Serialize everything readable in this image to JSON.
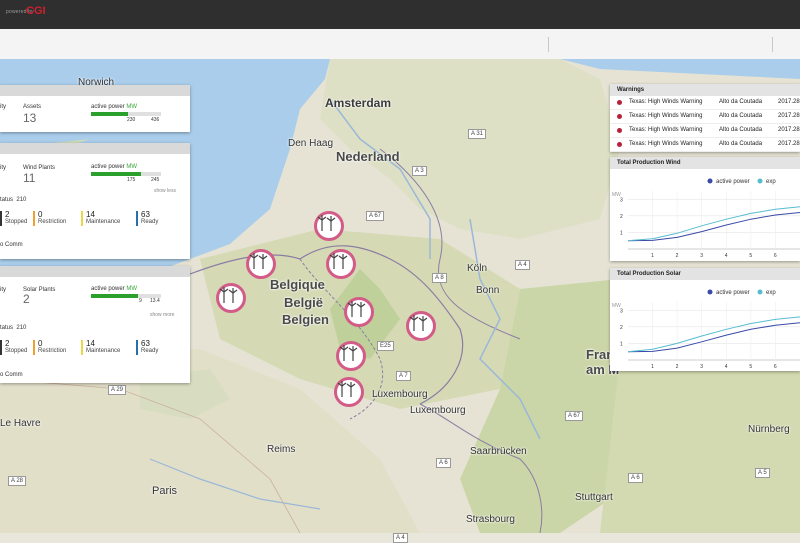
{
  "header": {
    "powered_by": "powered by",
    "logo": "CGI"
  },
  "map": {
    "cities": [
      "Amsterdam",
      "Den Haag",
      "Köln",
      "Bonn",
      "Reims",
      "Paris",
      "Le Havre",
      "Luxembourg",
      "Saarbrücken",
      "Stuttgart",
      "Strasbourg",
      "Nürnberg",
      "Norwich"
    ],
    "countries": {
      "nl": "Nederland",
      "be1": "Belgique",
      "be2": "België",
      "be3": "Belgien",
      "fr1": "Fran",
      "fr2": "am M",
      "lu": "Luxembourg"
    },
    "roads": [
      "A 31",
      "A 67",
      "A 3",
      "A 4",
      "A 8",
      "A 7",
      "A 6",
      "A 5",
      "E25",
      "A 29",
      "A 28",
      "A 4",
      "A 4",
      "A 67",
      "A 6"
    ]
  },
  "cards": {
    "assets": {
      "label_left": "ity",
      "assets_label": "Assets",
      "assets_value": "13",
      "power_label": "active power",
      "unit": "MW",
      "p1": "230",
      "p2": "436"
    },
    "wind": {
      "label_left": "ity",
      "plants_label": "Wind Plants",
      "plants_value": "11",
      "power_label": "active power",
      "unit": "MW",
      "p1": "175",
      "p2": "245",
      "show_less": "show less",
      "status_label": "tatus",
      "status_value": "210",
      "stats": [
        {
          "num": "2",
          "txt": "Stopped"
        },
        {
          "num": "0",
          "txt": "Restriction"
        },
        {
          "num": "14",
          "txt": "Maintenance"
        },
        {
          "num": "63",
          "txt": "Ready"
        }
      ],
      "no_comm": "o Comm"
    },
    "solar": {
      "label_left": "ity",
      "plants_label": "Solar Plants",
      "plants_value": "2",
      "power_label": "active power",
      "unit": "MW",
      "p1": "9",
      "p2": "13.4",
      "show_more": "show more",
      "status_label": "tatus",
      "status_value": "210",
      "stats": [
        {
          "num": "2",
          "txt": "Stopped"
        },
        {
          "num": "0",
          "txt": "Restriction"
        },
        {
          "num": "14",
          "txt": "Maintenance"
        },
        {
          "num": "63",
          "txt": "Ready"
        }
      ],
      "no_comm": "o Comm"
    }
  },
  "warnings": {
    "title": "Warnings",
    "rows": [
      {
        "msg": "Texas: High Winds Warning",
        "site": "Alto da Coutada",
        "date": "2017.28"
      },
      {
        "msg": "Texas: High Winds Warning",
        "site": "Alto da Coutada",
        "date": "2017.28"
      },
      {
        "msg": "Texas: High Winds Warning",
        "site": "Alto da Coutada",
        "date": "2017.28"
      },
      {
        "msg": "Texas: High Winds Warning",
        "site": "Alto da Coutada",
        "date": "2017.28"
      }
    ]
  },
  "charts": {
    "wind": {
      "title": "Total Production Wind",
      "ylabel": "MW",
      "legend": [
        "active power",
        "exp"
      ]
    },
    "solar": {
      "title": "Total Production Solar",
      "ylabel": "MW",
      "legend": [
        "active power",
        "exp"
      ]
    }
  },
  "chart_data": [
    {
      "type": "line",
      "title": "Total Production Wind",
      "ylabel": "MW",
      "x": [
        0,
        1,
        2,
        3,
        4,
        5,
        6,
        7
      ],
      "xticks": [
        1,
        2,
        3,
        4,
        5,
        6
      ],
      "yticks": [
        1,
        2,
        3
      ],
      "ylim": [
        0,
        3.5
      ],
      "series": [
        {
          "name": "active power",
          "color": "#3a4aa8",
          "values": [
            0.5,
            0.52,
            0.7,
            1.05,
            1.45,
            1.8,
            2.05,
            2.2
          ]
        },
        {
          "name": "exp",
          "color": "#57bcd0",
          "values": [
            0.5,
            0.62,
            0.95,
            1.4,
            1.8,
            2.15,
            2.4,
            2.55
          ]
        }
      ]
    },
    {
      "type": "line",
      "title": "Total Production Solar",
      "ylabel": "MW",
      "x": [
        0,
        1,
        2,
        3,
        4,
        5,
        6,
        7
      ],
      "xticks": [
        1,
        2,
        3,
        4,
        5,
        6
      ],
      "yticks": [
        1,
        2,
        3
      ],
      "ylim": [
        0,
        3.5
      ],
      "series": [
        {
          "name": "active power",
          "color": "#3a4aa8",
          "values": [
            0.5,
            0.52,
            0.72,
            1.1,
            1.5,
            1.85,
            2.1,
            2.25
          ]
        },
        {
          "name": "exp",
          "color": "#57bcd0",
          "values": [
            0.5,
            0.65,
            1.0,
            1.45,
            1.85,
            2.2,
            2.45,
            2.6
          ]
        }
      ]
    }
  ],
  "colors": {
    "marker_border": "#d35b87",
    "stopped": "#333333",
    "restriction": "#f0a030",
    "maintenance": "#e8d94a",
    "ready": "#2a6fa8",
    "warning_dot": "#b9213a"
  }
}
